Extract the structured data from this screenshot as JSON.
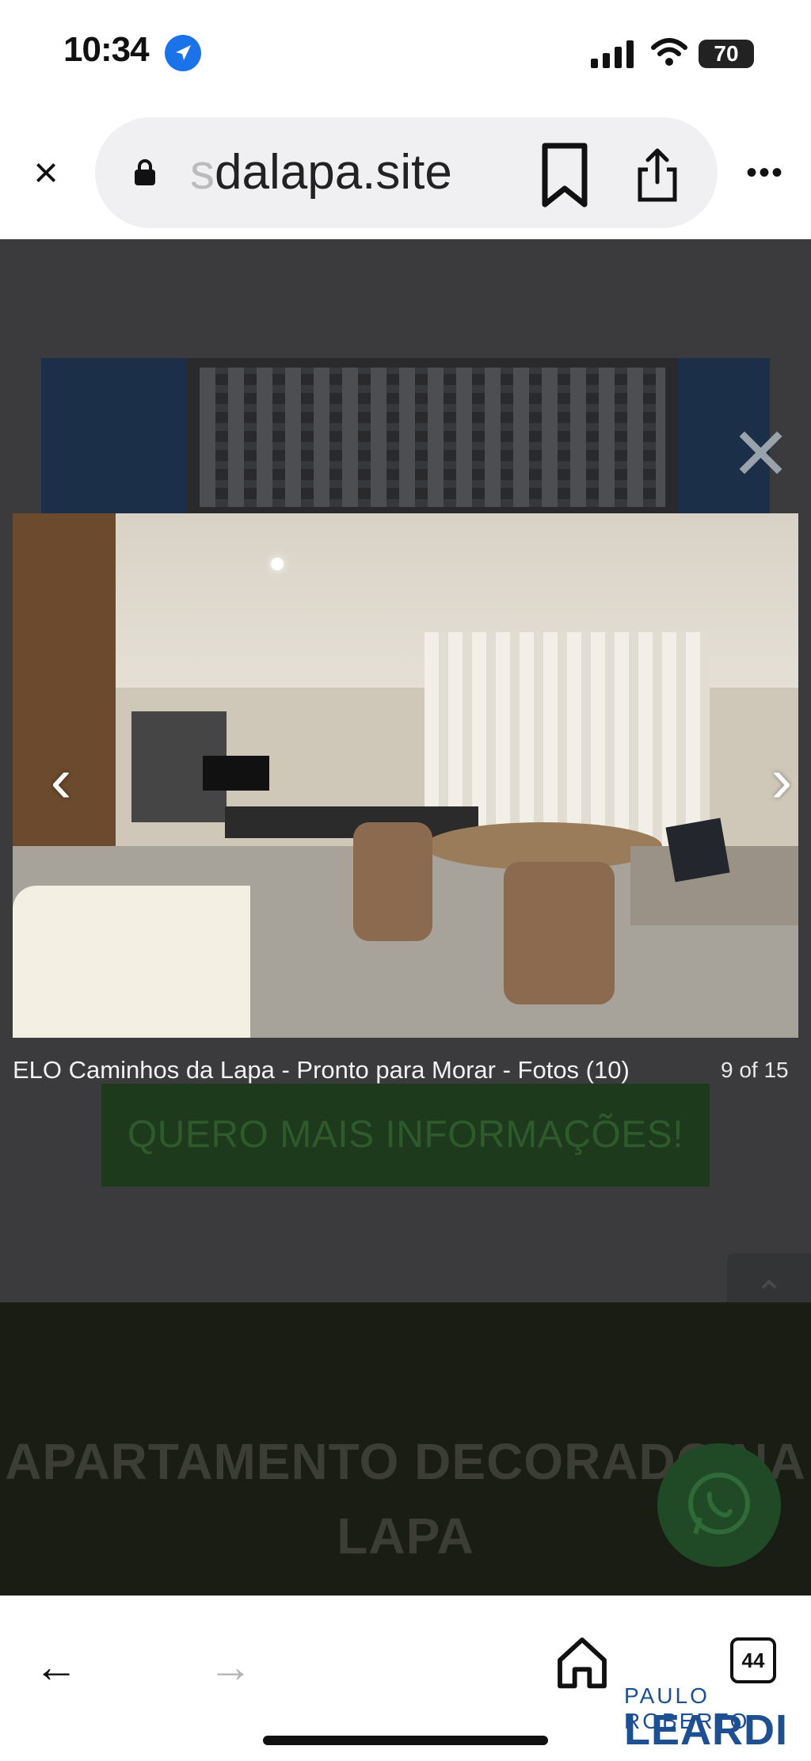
{
  "status_bar": {
    "time": "10:34",
    "battery": "70"
  },
  "browser": {
    "url_faded": "s",
    "url": "dalapa.site"
  },
  "lightbox": {
    "caption": "ELO Caminhos da Lapa - Pronto para Morar - Fotos (10)",
    "counter": "9 of 15",
    "close_glyph": "✕",
    "prev_glyph": "‹",
    "next_glyph": "›"
  },
  "page": {
    "cta_label": "QUERO MAIS INFORMAÇÕES!",
    "footer_title": "APARTAMENTO DECORADO NA LAPA",
    "back_to_top_glyph": "⌃"
  },
  "toolbar": {
    "tab_count": "44"
  },
  "watermark": {
    "line1": "PAULO ROBERTO",
    "line2": "LEARDI"
  }
}
